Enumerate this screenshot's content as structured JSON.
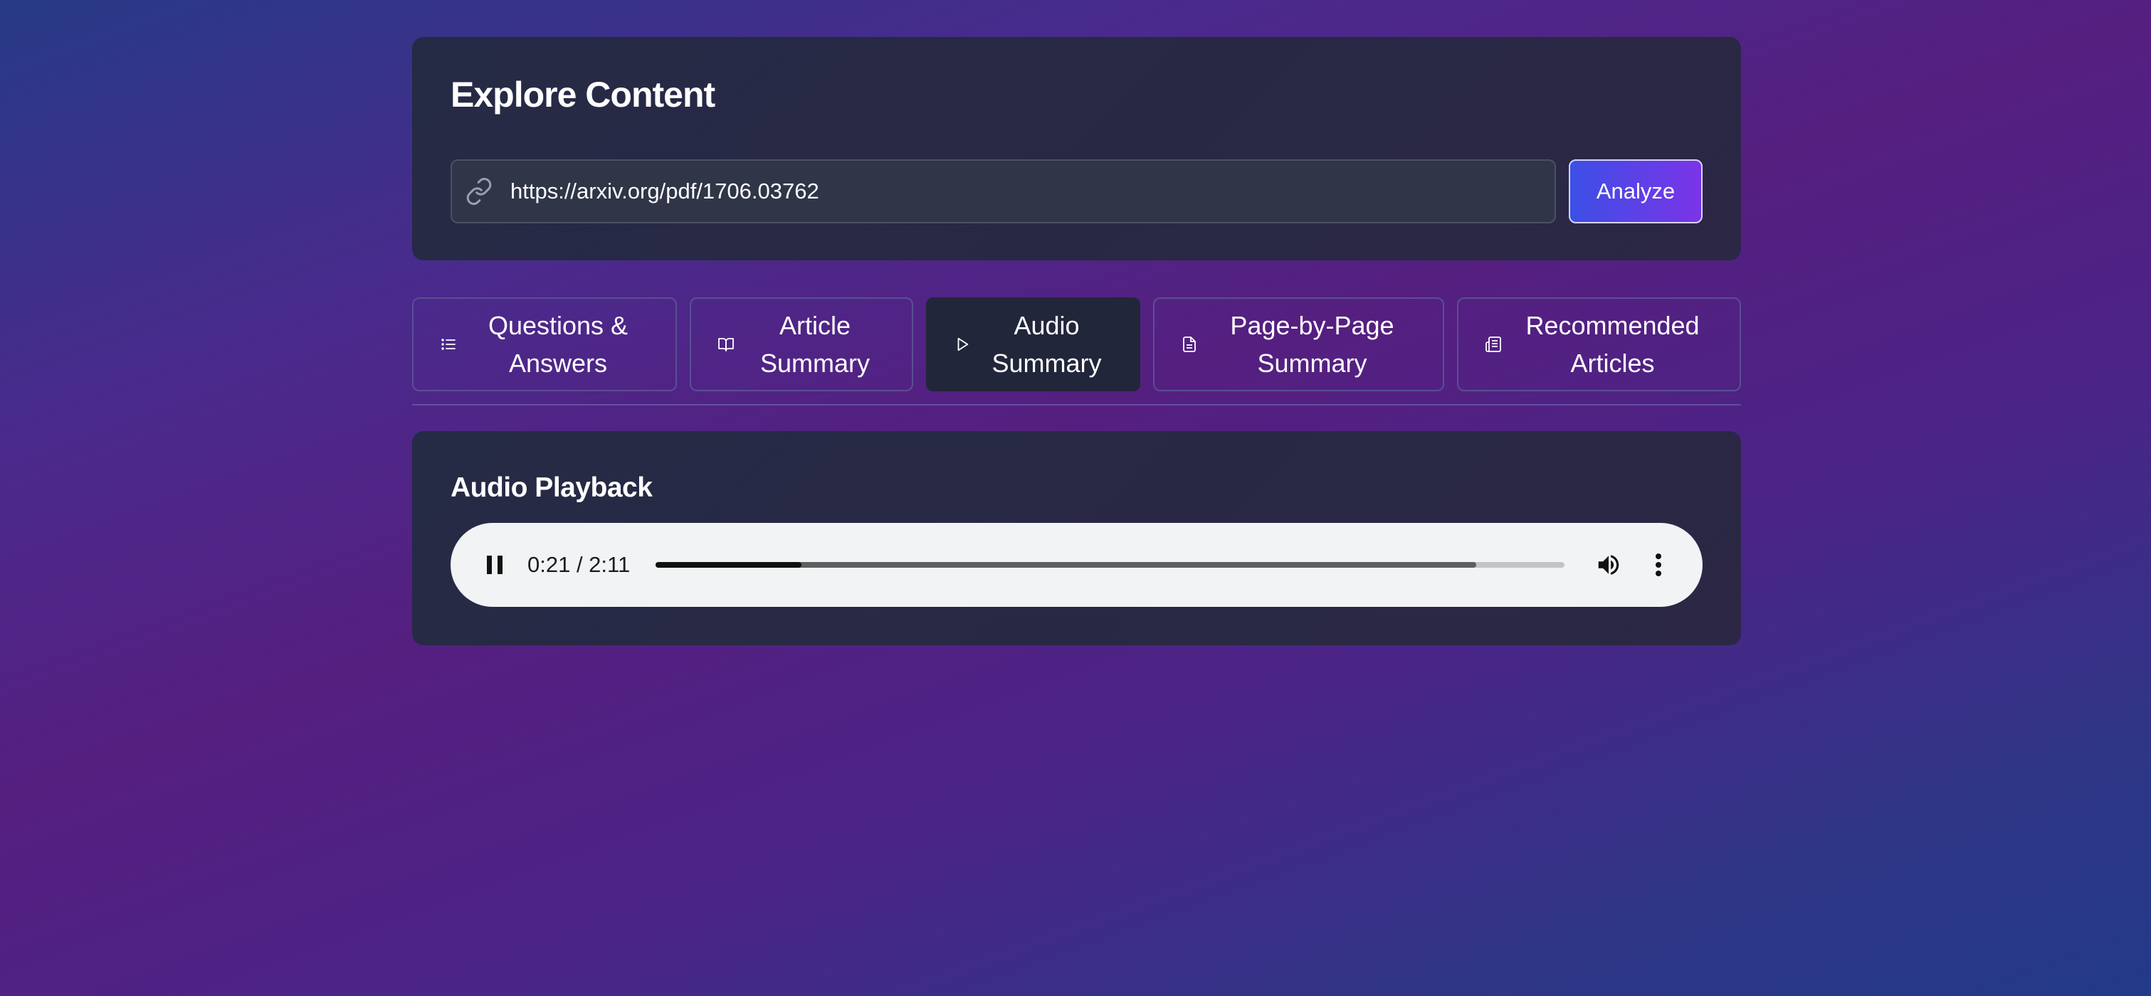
{
  "explore": {
    "title": "Explore Content",
    "url_value": "https://arxiv.org/pdf/1706.03762",
    "analyze_label": "Analyze"
  },
  "tabs": [
    {
      "label": "Questions &\nAnswers",
      "icon": "list-icon",
      "active": false
    },
    {
      "label": "Article\nSummary",
      "icon": "book-open-icon",
      "active": false
    },
    {
      "label": "Audio\nSummary",
      "icon": "play-icon",
      "active": true
    },
    {
      "label": "Page-by-Page\nSummary",
      "icon": "document-icon",
      "active": false
    },
    {
      "label": "Recommended\nArticles",
      "icon": "newspaper-icon",
      "active": false
    }
  ],
  "audio": {
    "title": "Audio Playback",
    "time_display": "0:21 / 2:11",
    "played_fraction": 0.16,
    "buffered_fraction": 0.903,
    "state": "playing"
  },
  "colors": {
    "accent_start": "#3c4fe6",
    "accent_end": "#7b34e8",
    "card_bg": "#252a45",
    "active_tab_bg": "#22263a"
  }
}
